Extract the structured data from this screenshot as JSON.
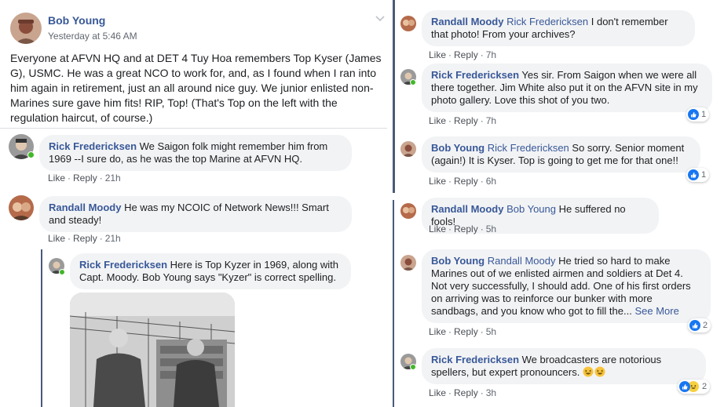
{
  "post": {
    "author": "Bob Young",
    "timestamp": "Yesterday at 5:46 AM",
    "text": "Everyone at AFVN HQ and at DET 4 Tuy Hoa remembers Top Kyser (James G), USMC. He was a great NCO to work for, and, as I found when I ran into him again in retirement, just an all around nice guy. We junior enlisted non-Marines sure gave him fits! RIP, Top! (That's Top on the left with the regulation haircut, of course.)"
  },
  "actions": {
    "like": "Like",
    "reply": "Reply",
    "see_more": "See More"
  },
  "left_comments": [
    {
      "author": "Rick Fredericksen",
      "text": "We Saigon folk might remember him from 1969 --I sure do, as he was the top Marine at AFVN HQ.",
      "time": "21h"
    },
    {
      "author": "Randall Moody",
      "text": "He was my NCOIC of Network News!!! Smart and steady!",
      "time": "21h"
    }
  ],
  "left_reply": {
    "author": "Rick Fredericksen",
    "text": "Here is Top Kyzer in 1969, along with Capt. Moody. Bob Young says \"Kyzer\" is correct spelling."
  },
  "right_comments": [
    {
      "author": "Randall Moody",
      "mention": "Rick Fredericksen",
      "text": "I don't remember that photo! From your archives?",
      "time": "7h"
    },
    {
      "author": "Rick Fredericksen",
      "mention": "",
      "text": "Yes sir. From Saigon when we were all there together. Jim White also put it on the AFVN site in my photo gallery. Love this shot of you two.",
      "time": "7h",
      "reactions": "1"
    },
    {
      "author": "Bob Young",
      "mention": "Rick Fredericksen",
      "text": "So sorry. Senior moment (again!) It is Kyser. Top is going to get me for that one!!",
      "time": "6h",
      "reactions": "1"
    },
    {
      "author": "Randall Moody",
      "mention": "Bob Young",
      "text": "He suffered no fools!",
      "time": "5h"
    },
    {
      "author": "Bob Young",
      "mention": "Randall Moody",
      "text": "He tried so hard to make Marines out of we enlisted airmen and soldiers at Det 4. Not very successfully, I should add. One of his first orders on arriving was to reinforce our bunker with more sandbags, and you know who got to fill the...",
      "time": "5h",
      "reactions": "2"
    },
    {
      "author": "Rick Fredericksen",
      "mention": "",
      "text": "We broadcasters are notorious spellers, but expert pronouncers.",
      "time": "3h",
      "reactions": "2"
    }
  ],
  "colors": {
    "link": "#385898",
    "bubble": "#f2f3f5",
    "like_blue": "#1877f2",
    "online": "#42b72a"
  }
}
